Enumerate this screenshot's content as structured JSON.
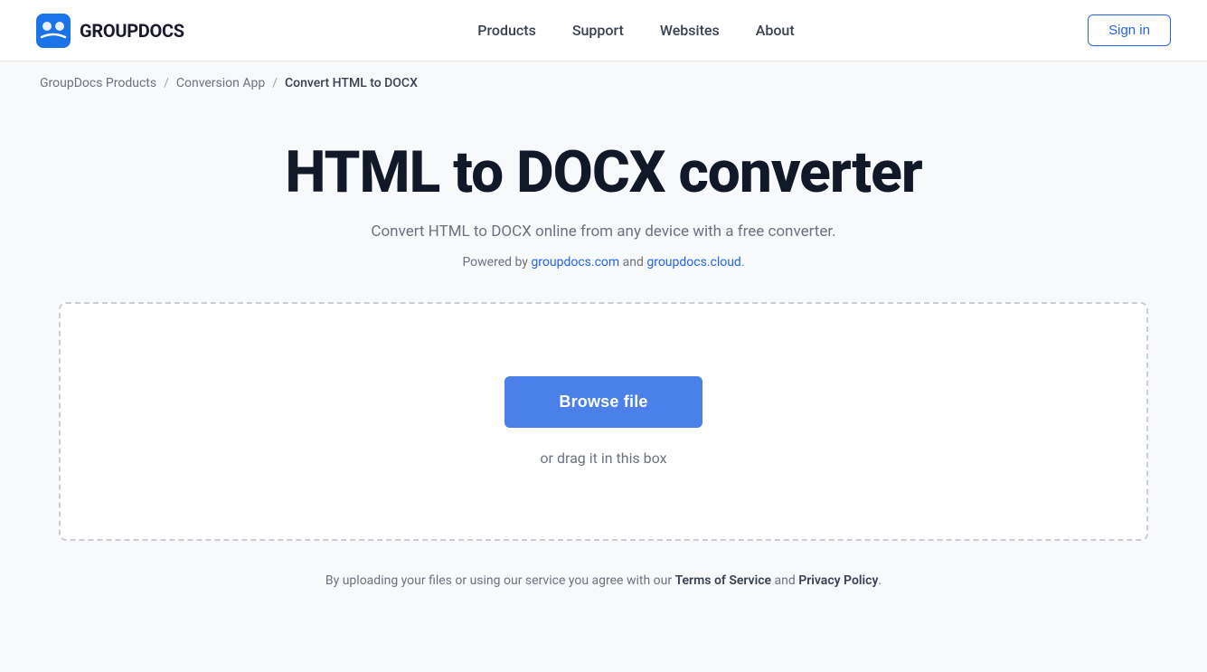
{
  "brand": {
    "name": "GROUPDOCS",
    "logo_alt": "GroupDocs logo"
  },
  "nav": {
    "items": [
      {
        "label": "Products",
        "href": "#"
      },
      {
        "label": "Support",
        "href": "#"
      },
      {
        "label": "Websites",
        "href": "#"
      },
      {
        "label": "About",
        "href": "#"
      }
    ],
    "sign_in_label": "Sign in"
  },
  "breadcrumb": {
    "items": [
      {
        "label": "GroupDocs Products",
        "href": "#"
      },
      {
        "label": "Conversion App",
        "href": "#"
      },
      {
        "label": "Convert HTML to DOCX"
      }
    ]
  },
  "main": {
    "title": "HTML to DOCX converter",
    "subtitle": "Convert HTML to DOCX online from any device with a free converter.",
    "powered_by_prefix": "Powered by ",
    "powered_by_link1": "groupdocs.com",
    "powered_by_link1_href": "#",
    "powered_by_and": " and ",
    "powered_by_link2": "groupdocs.cloud",
    "powered_by_link2_href": "#",
    "powered_by_suffix": ".",
    "browse_button": "Browse file",
    "drag_text": "or drag it in this box"
  },
  "footer": {
    "notice_prefix": "By uploading your files or using our service you agree with our ",
    "tos_label": "Terms of Service",
    "tos_href": "#",
    "and": " and ",
    "privacy_label": "Privacy Policy",
    "privacy_href": "#",
    "notice_suffix": "."
  }
}
